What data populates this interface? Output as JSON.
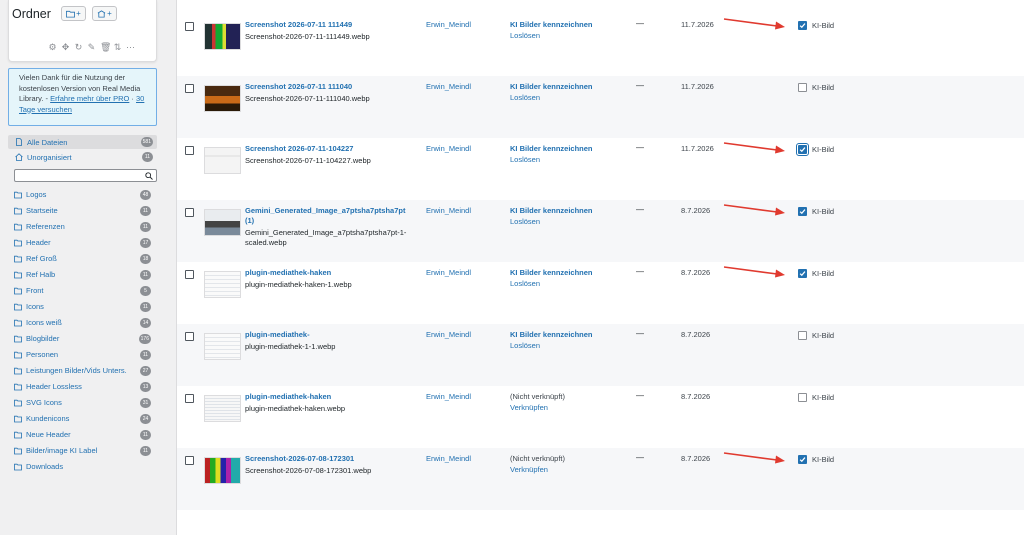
{
  "sidebar": {
    "title": "Ordner",
    "new_folder_btn": "+",
    "new_collection_btn": "+",
    "notice": {
      "text": "Vielen Dank für die Nutzung der kostenlosen Version von Real Media Library. -",
      "link": "Erfahre mehr über PRO",
      "trial": "30 Tage versuchen"
    },
    "all_files": {
      "label": "Alle Dateien",
      "count": "581"
    },
    "unorganized": {
      "label": "Unorganisiert",
      "count": "11"
    },
    "folders": [
      {
        "label": "Logos",
        "count": "48"
      },
      {
        "label": "Startseite",
        "count": "11"
      },
      {
        "label": "Referenzen",
        "count": "11"
      },
      {
        "label": "Header",
        "count": "17"
      },
      {
        "label": "Ref Groß",
        "count": "18"
      },
      {
        "label": "Ref Halb",
        "count": "11"
      },
      {
        "label": "Front",
        "count": "5"
      },
      {
        "label": "Icons",
        "count": "11"
      },
      {
        "label": "Icons weiß",
        "count": "14"
      },
      {
        "label": "Blogbilder",
        "count": "176"
      },
      {
        "label": "Personen",
        "count": "11"
      },
      {
        "label": "Leistungen Bilder/Vids Unters.",
        "count": "27"
      },
      {
        "label": "Header Lossless",
        "count": "13"
      },
      {
        "label": "SVG Icons",
        "count": "31"
      },
      {
        "label": "Kundenicons",
        "count": "24"
      },
      {
        "label": "Neue Header",
        "count": "11"
      },
      {
        "label": "Bilder/image KI Label",
        "count": "11"
      },
      {
        "label": "Downloads",
        "count": ""
      }
    ]
  },
  "rows": [
    {
      "title": "Screenshot 2026-07-11 111449",
      "title2": "",
      "file": "Screenshot-2026-07-11-111449.webp",
      "file2": "",
      "author": "Erwin_Meindl",
      "attach1": "KI Bilder kennzeichnen",
      "attach1_link": true,
      "attach2": "Loslösen",
      "dash": "—",
      "date": "11.7.2026",
      "ki_label": "KI-Bild",
      "ki_checked": true,
      "ki_focused": false,
      "arrow": true
    },
    {
      "title": "Screenshot 2026-07-11 111040",
      "title2": "",
      "file": "Screenshot-2026-07-11-111040.webp",
      "file2": "",
      "author": "Erwin_Meindl",
      "attach1": "KI Bilder kennzeichnen",
      "attach1_link": true,
      "attach2": "Loslösen",
      "dash": "—",
      "date": "11.7.2026",
      "ki_label": "KI-Bild",
      "ki_checked": false,
      "ki_focused": false,
      "arrow": false
    },
    {
      "title": "Screenshot 2026-07-11-104227",
      "title2": "",
      "file": "Screenshot-2026-07-11-104227.webp",
      "file2": "",
      "author": "Erwin_Meindl",
      "attach1": "KI Bilder kennzeichnen",
      "attach1_link": true,
      "attach2": "Loslösen",
      "dash": "—",
      "date": "11.7.2026",
      "ki_label": "KI-Bild",
      "ki_checked": true,
      "ki_focused": true,
      "arrow": true
    },
    {
      "title": "Gemini_Generated_Image_a7ptsha7ptsha7pt",
      "title2": "(1)",
      "file": "Gemini_Generated_Image_a7ptsha7ptsha7pt-1-",
      "file2": "scaled.webp",
      "author": "Erwin_Meindl",
      "attach1": "KI Bilder kennzeichnen",
      "attach1_link": true,
      "attach2": "Loslösen",
      "dash": "—",
      "date": "8.7.2026",
      "ki_label": "KI-Bild",
      "ki_checked": true,
      "ki_focused": false,
      "arrow": true
    },
    {
      "title": "plugin-mediathek-haken",
      "title2": "",
      "file": "plugin-mediathek-haken-1.webp",
      "file2": "",
      "author": "Erwin_Meindl",
      "attach1": "KI Bilder kennzeichnen",
      "attach1_link": true,
      "attach2": "Loslösen",
      "dash": "—",
      "date": "8.7.2026",
      "ki_label": "KI-Bild",
      "ki_checked": true,
      "ki_focused": false,
      "arrow": true
    },
    {
      "title": "plugin-mediathek-",
      "title2": "",
      "file": "plugin-mediathek-1-1.webp",
      "file2": "",
      "author": "Erwin_Meindl",
      "attach1": "KI Bilder kennzeichnen",
      "attach1_link": true,
      "attach2": "Loslösen",
      "dash": "—",
      "date": "8.7.2026",
      "ki_label": "KI-Bild",
      "ki_checked": false,
      "ki_focused": false,
      "arrow": false
    },
    {
      "title": "plugin-mediathek-haken",
      "title2": "",
      "file": "plugin-mediathek-haken.webp",
      "file2": "",
      "author": "Erwin_Meindl",
      "attach1": "(Nicht verknüpft)",
      "attach1_link": false,
      "attach2": "Verknüpfen",
      "dash": "—",
      "date": "8.7.2026",
      "ki_label": "KI-Bild",
      "ki_checked": false,
      "ki_focused": false,
      "arrow": false
    },
    {
      "title": "Screenshot-2026-07-08-172301",
      "title2": "",
      "file": "Screenshot-2026-07-08-172301.webp",
      "file2": "",
      "author": "Erwin_Meindl",
      "attach1": "(Nicht verknüpft)",
      "attach1_link": false,
      "attach2": "Verknüpfen",
      "dash": "—",
      "date": "8.7.2026",
      "ki_label": "KI-Bild",
      "ki_checked": true,
      "ki_focused": false,
      "arrow": true
    }
  ],
  "colors": {
    "link": "#2271b1",
    "arrow": "#e03a2f",
    "check": "#2271b1"
  }
}
